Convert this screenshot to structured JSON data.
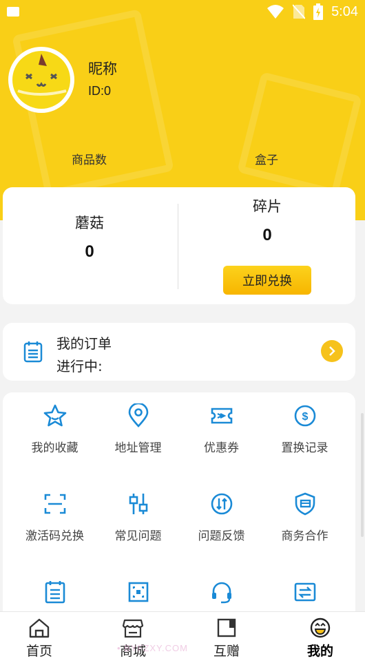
{
  "status_bar": {
    "time": "5:04"
  },
  "profile": {
    "nickname": "昵称",
    "id_text": "ID:0"
  },
  "stats": {
    "goods_label": "商品数",
    "box_label": "盒子"
  },
  "exchange": {
    "mushroom_label": "蘑菇",
    "mushroom_value": "0",
    "fragment_label": "碎片",
    "fragment_value": "0",
    "redeem_button": "立即兑换"
  },
  "orders": {
    "title": "我的订单",
    "status": "进行中:"
  },
  "grid": {
    "items": [
      {
        "label": "我的收藏",
        "icon": "star-icon"
      },
      {
        "label": "地址管理",
        "icon": "location-pin-icon"
      },
      {
        "label": "优惠券",
        "icon": "coupon-icon"
      },
      {
        "label": "置换记录",
        "icon": "dollar-circle-icon"
      },
      {
        "label": "激活码兑换",
        "icon": "scan-icon"
      },
      {
        "label": "常见问题",
        "icon": "sliders-icon"
      },
      {
        "label": "问题反馈",
        "icon": "exchange-circle-icon"
      },
      {
        "label": "商务合作",
        "icon": "shield-icon"
      },
      {
        "label": "",
        "icon": "clipboard-icon"
      },
      {
        "label": "",
        "icon": "qr-frame-icon"
      },
      {
        "label": "",
        "icon": "headset-icon"
      },
      {
        "label": "",
        "icon": "transfer-icon"
      }
    ]
  },
  "nav": {
    "items": [
      {
        "label": "首页",
        "icon": "home-icon"
      },
      {
        "label": "商城",
        "icon": "store-icon"
      },
      {
        "label": "互赠",
        "icon": "gift-box-icon"
      },
      {
        "label": "我的",
        "icon": "smile-icon"
      }
    ]
  },
  "watermark": "• BYFZXY.COM",
  "colors": {
    "brand_yellow": "#f9cf17",
    "icon_blue": "#1a8ad6",
    "button_yellow": "#f7b500"
  }
}
